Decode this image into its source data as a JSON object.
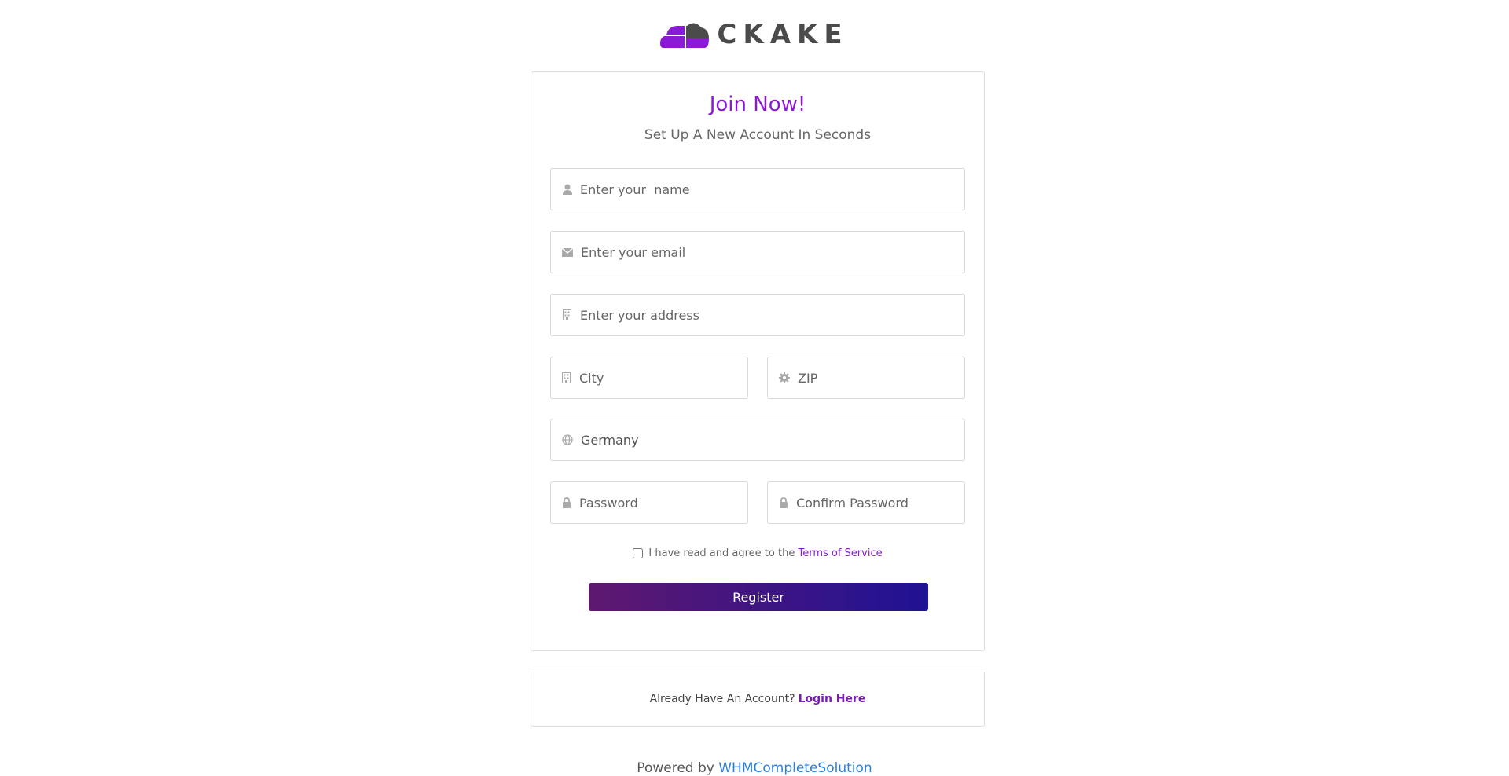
{
  "logo": {
    "text": "CKAKE",
    "primary_color": "#8a1ad6",
    "dark_color": "#4b4b4b"
  },
  "form": {
    "title": "Join Now!",
    "subtitle": "Set Up A New Account In Seconds",
    "fields": {
      "name": {
        "placeholder": "Enter your  name",
        "icon": "user-icon"
      },
      "email": {
        "placeholder": "Enter your email",
        "icon": "envelope-icon"
      },
      "address": {
        "placeholder": "Enter your address",
        "icon": "building-icon"
      },
      "city": {
        "placeholder": "City",
        "icon": "building-icon"
      },
      "zip": {
        "placeholder": "ZIP",
        "icon": "gear-icon"
      },
      "country": {
        "value": "Germany",
        "icon": "globe-icon"
      },
      "password": {
        "placeholder": "Password",
        "icon": "lock-icon"
      },
      "confirm_password": {
        "placeholder": "Confirm Password",
        "icon": "lock-icon"
      }
    },
    "terms_text": "I have read and agree to the",
    "terms_link": "Terms of Service",
    "register_label": "Register",
    "register_gradient": [
      "#5f1870",
      "#1f1294"
    ]
  },
  "login": {
    "text": "Already Have An Account?",
    "link": "Login Here"
  },
  "footer": {
    "powered_text": "Powered by",
    "powered_link": "WHMCompleteSolution",
    "link_color": "#2a7fd8"
  }
}
